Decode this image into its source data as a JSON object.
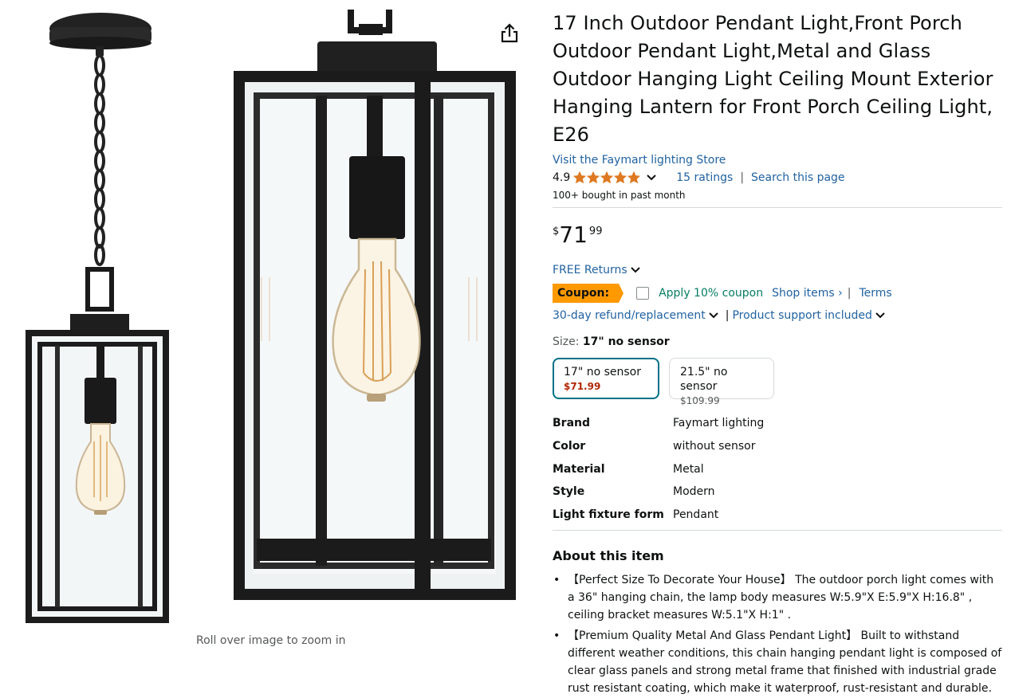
{
  "product": {
    "title": "17 Inch Outdoor Pendant Light,Front Porch Outdoor Pendant Light,Metal and Glass Outdoor Hanging Light Ceiling Mount Exterior Hanging Lantern for Front Porch Ceiling Light, E26",
    "store_link": "Visit the Faymart lighting Store",
    "rating_value": "4.9",
    "rating_stars": 4.9,
    "ratings_count": "15 ratings",
    "search_page": "Search this page",
    "separator": "|",
    "bought": "100+ bought in past month"
  },
  "price": {
    "symbol": "$",
    "whole": "71",
    "fraction": "99"
  },
  "returns": "FREE Returns",
  "coupon": {
    "badge": "Coupon:",
    "apply": "Apply 10% coupon",
    "shop_items": "Shop items ›",
    "separator": "|",
    "terms": "Terms"
  },
  "refund": {
    "label": "30-day refund/replacement",
    "separator": "|",
    "support": "Product support included"
  },
  "size": {
    "label": "Size:",
    "selected": "17\" no sensor",
    "options": [
      {
        "name": "17\" no sensor",
        "price": "$71.99"
      },
      {
        "name": "21.5\" no sensor",
        "price": "$109.99"
      }
    ]
  },
  "specs": [
    {
      "key": "Brand",
      "value": "Faymart lighting"
    },
    {
      "key": "Color",
      "value": "without sensor"
    },
    {
      "key": "Material",
      "value": "Metal"
    },
    {
      "key": "Style",
      "value": "Modern"
    },
    {
      "key": "Light fixture form",
      "value": "Pendant"
    }
  ],
  "about": {
    "heading": "About this item",
    "bullets": [
      "【Perfect Size To Decorate Your House】 The outdoor porch light comes with a 36\" hanging chain, the lamp body measures W:5.9\"X E:5.9\"X H:16.8\" , ceiling bracket measures W:5.1\"X H:1\" .",
      "【Premium Quality Metal And Glass Pendant Light】 Built to withstand different weather conditions, this chain hanging pendant light is composed of clear glass panels and strong metal frame that finished with industrial grade rust resistant coating, which make it waterproof, rust-resistant and durable."
    ]
  },
  "image": {
    "zoom_hint": "Roll over image to zoom in"
  },
  "icons": {
    "share": "share-icon",
    "star": "star-icon",
    "chevron": "chevron-down-icon"
  },
  "colors": {
    "link": "#2162a1",
    "coupon": "#ff9900",
    "star": "#de7921",
    "selected_border": "#007185",
    "price_red": "#b12704"
  }
}
